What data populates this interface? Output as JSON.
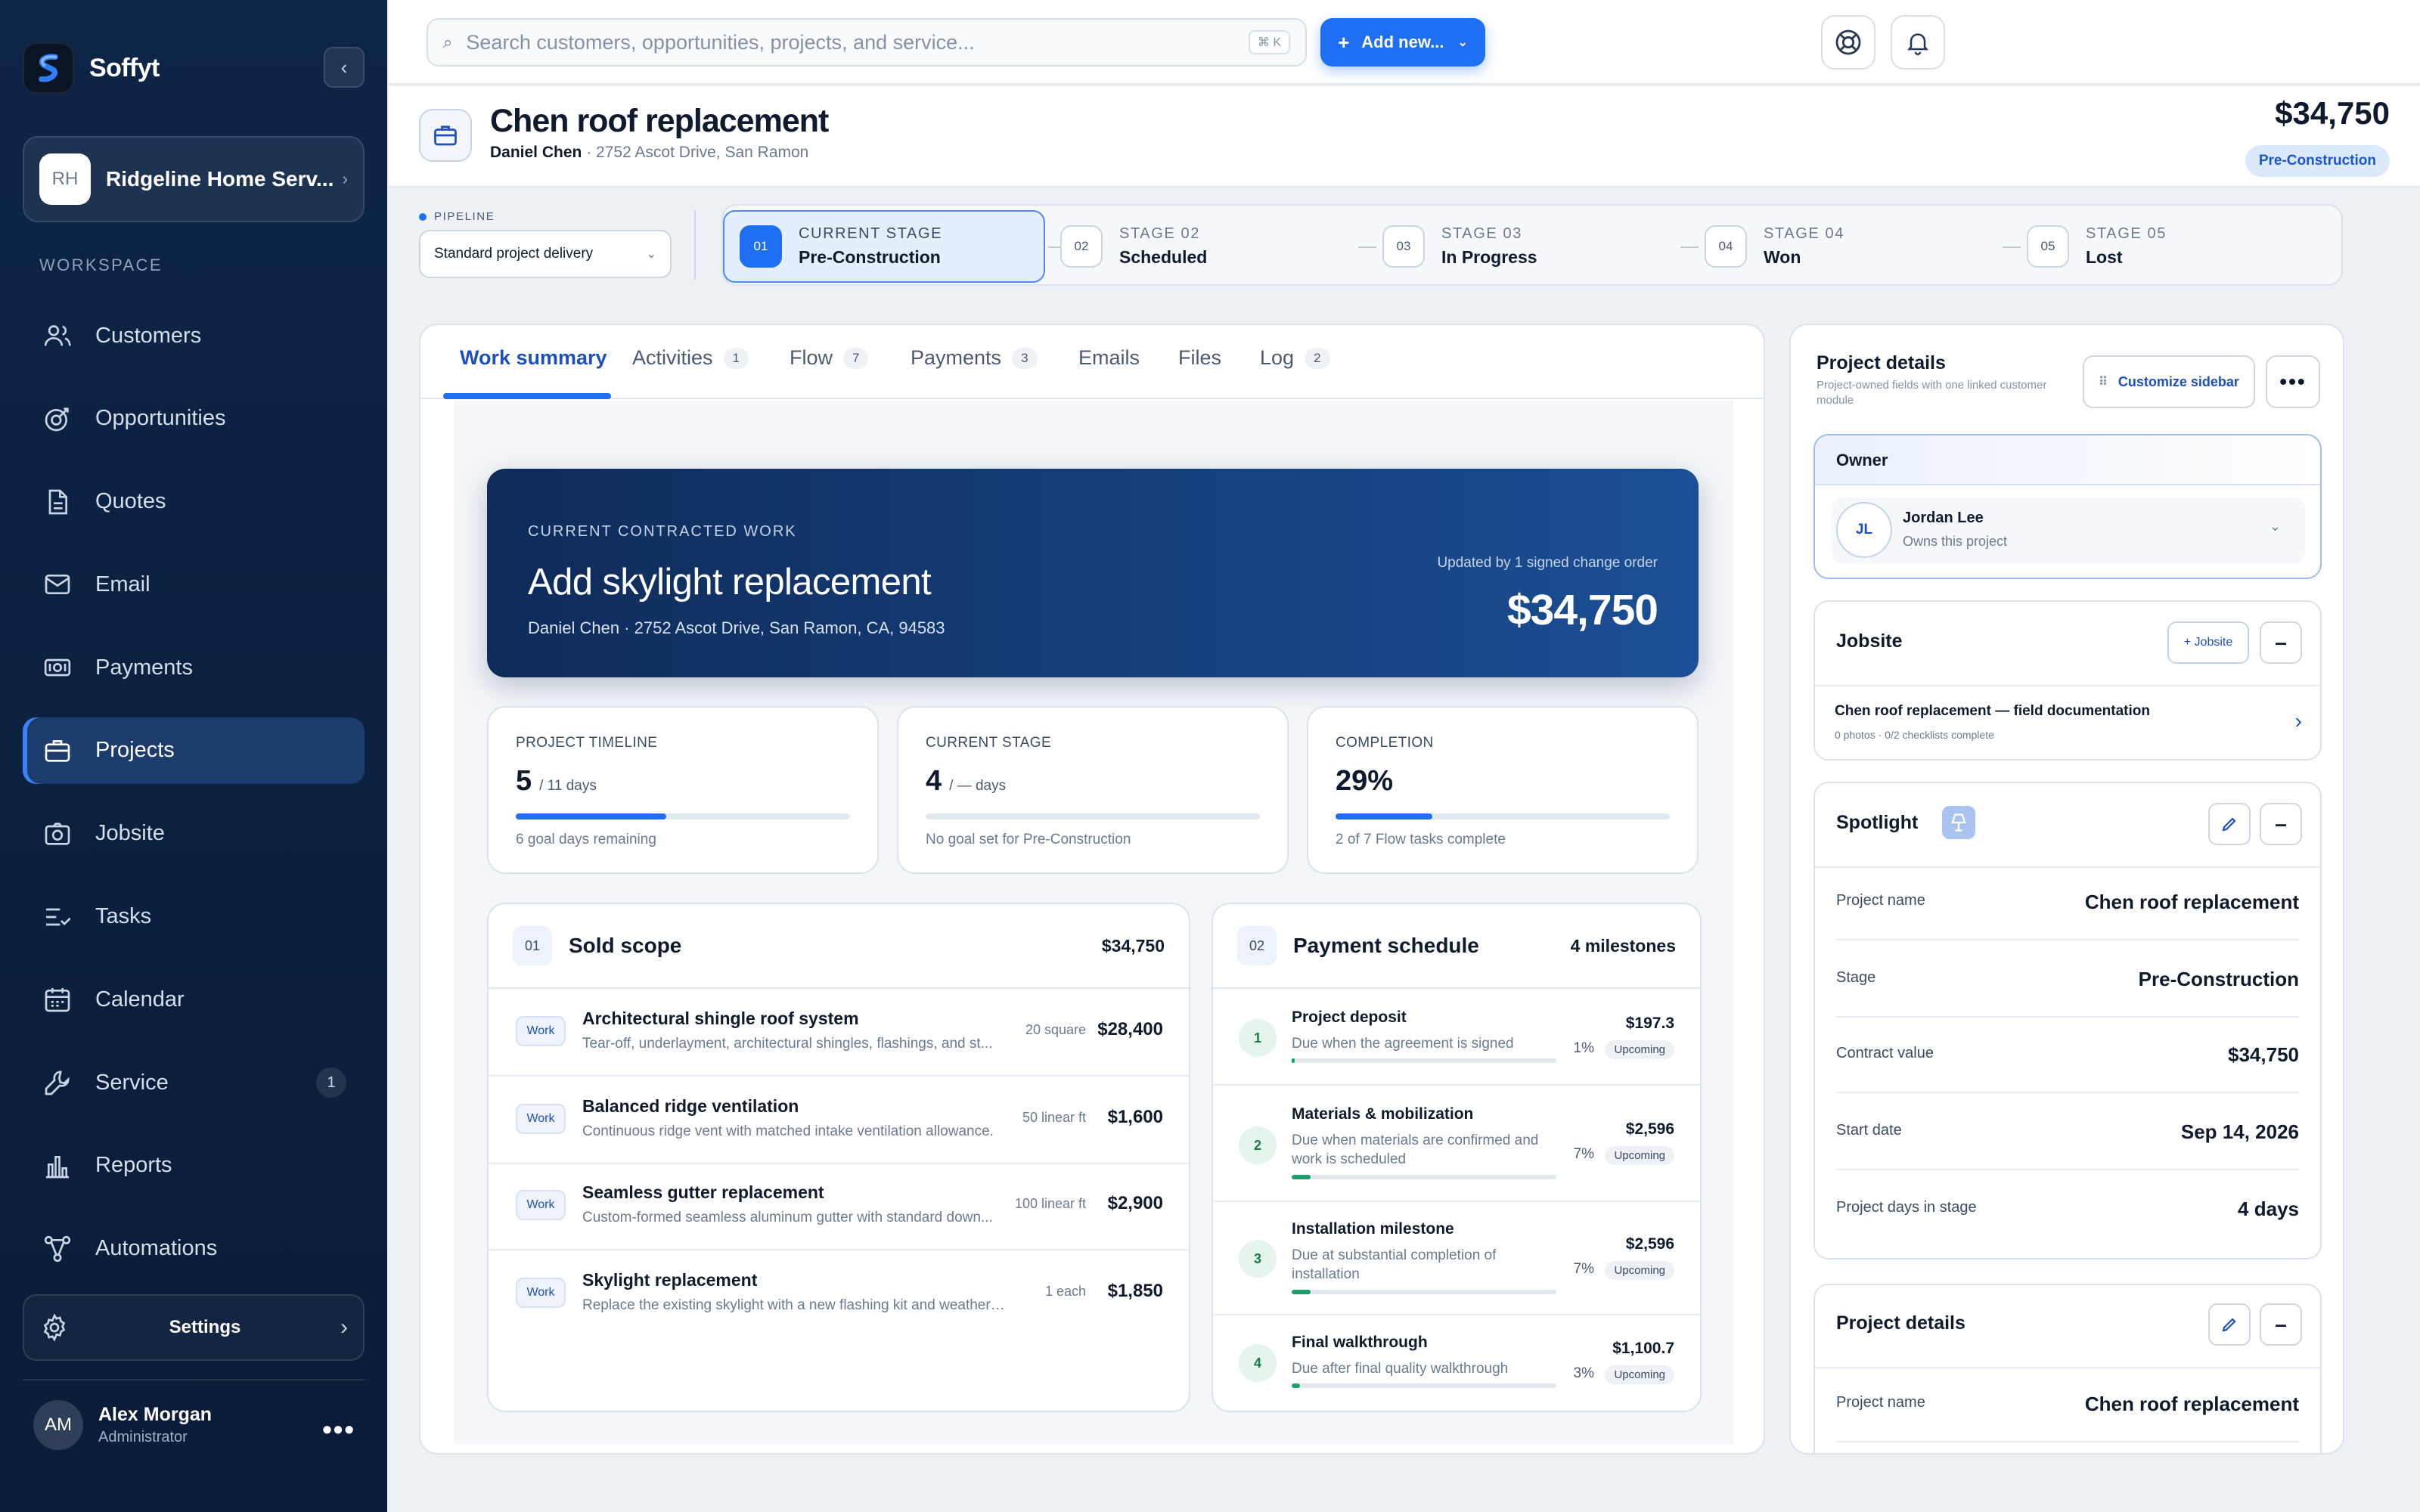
{
  "app": {
    "name": "Soffyt"
  },
  "org": {
    "initials": "RH",
    "name": "Ridgeline Home Serv..."
  },
  "workspace_label": "WORKSPACE",
  "nav": [
    {
      "label": "Customers",
      "icon": "users-icon"
    },
    {
      "label": "Opportunities",
      "icon": "target-icon"
    },
    {
      "label": "Quotes",
      "icon": "document-icon"
    },
    {
      "label": "Email",
      "icon": "mail-icon"
    },
    {
      "label": "Payments",
      "icon": "cash-icon"
    },
    {
      "label": "Projects",
      "icon": "briefcase-icon",
      "active": true
    },
    {
      "label": "Jobsite",
      "icon": "camera-icon"
    },
    {
      "label": "Tasks",
      "icon": "checklist-icon"
    },
    {
      "label": "Calendar",
      "icon": "calendar-icon"
    },
    {
      "label": "Service",
      "icon": "wrench-icon",
      "badge": "1"
    },
    {
      "label": "Reports",
      "icon": "bar-chart-icon"
    },
    {
      "label": "Automations",
      "icon": "flow-icon"
    }
  ],
  "settings": {
    "label": "Settings"
  },
  "user": {
    "initials": "AM",
    "name": "Alex Morgan",
    "role": "Administrator"
  },
  "search": {
    "placeholder": "Search customers, opportunities, projects, and service...",
    "shortcut": "⌘ K"
  },
  "add_new": {
    "label": "Add new..."
  },
  "project": {
    "title": "Chen roof replacement",
    "customer": "Daniel Chen",
    "address": "2752 Ascot Drive, San Ramon",
    "amount": "$34,750",
    "stage_pill": "Pre-Construction"
  },
  "pipeline": {
    "label": "PIPELINE",
    "value": "Standard project delivery"
  },
  "stages": [
    {
      "num": "01",
      "label": "CURRENT STAGE",
      "name": "Pre-Construction",
      "current": true
    },
    {
      "num": "02",
      "label": "STAGE 02",
      "name": "Scheduled"
    },
    {
      "num": "03",
      "label": "STAGE 03",
      "name": "In Progress"
    },
    {
      "num": "04",
      "label": "STAGE 04",
      "name": "Won"
    },
    {
      "num": "05",
      "label": "STAGE 05",
      "name": "Lost"
    }
  ],
  "tabs": [
    {
      "label": "Work summary",
      "active": true
    },
    {
      "label": "Activities",
      "count": "1"
    },
    {
      "label": "Flow",
      "count": "7"
    },
    {
      "label": "Payments",
      "count": "3"
    },
    {
      "label": "Emails"
    },
    {
      "label": "Files"
    },
    {
      "label": "Log",
      "count": "2"
    }
  ],
  "hero": {
    "eyebrow": "CURRENT CONTRACTED WORK",
    "title": "Add skylight replacement",
    "address": "Daniel Chen · 2752 Ascot Drive, San Ramon, CA, 94583",
    "updated": "Updated by 1 signed change order",
    "amount": "$34,750"
  },
  "kpis": [
    {
      "label": "PROJECT TIMELINE",
      "value": "5",
      "suffix": "/ 11 days",
      "progress": 45,
      "note": "6 goal days remaining"
    },
    {
      "label": "CURRENT STAGE",
      "value": "4",
      "suffix": "/ — days",
      "progress": 0,
      "note": "No goal set for Pre-Construction"
    },
    {
      "label": "COMPLETION",
      "value": "29%",
      "suffix": "",
      "progress": 29,
      "note": "2 of 7 Flow tasks complete"
    }
  ],
  "scope": {
    "num": "01",
    "title": "Sold scope",
    "total": "$34,750",
    "items": [
      {
        "tag": "Work",
        "name": "Architectural shingle roof system",
        "desc": "Tear-off, underlayment, architectural shingles, flashings, and st...",
        "qty": "20 square",
        "price": "$28,400"
      },
      {
        "tag": "Work",
        "name": "Balanced ridge ventilation",
        "desc": "Continuous ridge vent with matched intake ventilation allowance.",
        "qty": "50 linear ft",
        "price": "$1,600"
      },
      {
        "tag": "Work",
        "name": "Seamless gutter replacement",
        "desc": "Custom-formed seamless aluminum gutter with standard down...",
        "qty": "100 linear ft",
        "price": "$2,900"
      },
      {
        "tag": "Work",
        "name": "Skylight replacement",
        "desc": "Replace the existing skylight with a new flashing kit and weather seal.",
        "qty": "1 each",
        "price": "$1,850"
      }
    ]
  },
  "payments": {
    "num": "02",
    "title": "Payment schedule",
    "count": "4 milestones",
    "items": [
      {
        "n": "1",
        "name": "Project deposit",
        "desc": "Due when the agreement is signed",
        "amount": "$197.3",
        "pct": "1%",
        "progress": 1,
        "status": "Upcoming"
      },
      {
        "n": "2",
        "name": "Materials & mobilization",
        "desc": "Due when materials are confirmed and work is scheduled",
        "amount": "$2,596",
        "pct": "7%",
        "progress": 7,
        "status": "Upcoming"
      },
      {
        "n": "3",
        "name": "Installation milestone",
        "desc": "Due at substantial completion of installation",
        "amount": "$2,596",
        "pct": "7%",
        "progress": 7,
        "status": "Upcoming"
      },
      {
        "n": "4",
        "name": "Final walkthrough",
        "desc": "Due after final quality walkthrough",
        "amount": "$1,100.7",
        "pct": "3%",
        "progress": 3,
        "status": "Upcoming"
      }
    ]
  },
  "rside": {
    "title": "Project details",
    "subtitle": "Project-owned fields with one linked customer module",
    "customize": "Customize sidebar",
    "owner": {
      "header": "Owner",
      "initials": "JL",
      "name": "Jordan Lee",
      "note": "Owns this project"
    },
    "jobsite": {
      "header": "Jobsite",
      "add": "+ Jobsite",
      "item": "Chen roof replacement — field documentation",
      "meta": "0 photos · 0/2 checklists complete"
    },
    "spotlight": {
      "header": "Spotlight",
      "rows": [
        {
          "k": "Project name",
          "v": "Chen roof replacement"
        },
        {
          "k": "Stage",
          "v": "Pre-Construction"
        },
        {
          "k": "Contract value",
          "v": "$34,750"
        },
        {
          "k": "Start date",
          "v": "Sep 14, 2026"
        },
        {
          "k": "Project days in stage",
          "v": "4 days"
        }
      ]
    },
    "details": {
      "header": "Project details",
      "rows": [
        {
          "k": "Project name",
          "v": "Chen roof replacement"
        }
      ]
    }
  },
  "colors": {
    "accent": "#1f6ff5",
    "sidebar": "#0d2547",
    "success": "#1aa16b"
  }
}
